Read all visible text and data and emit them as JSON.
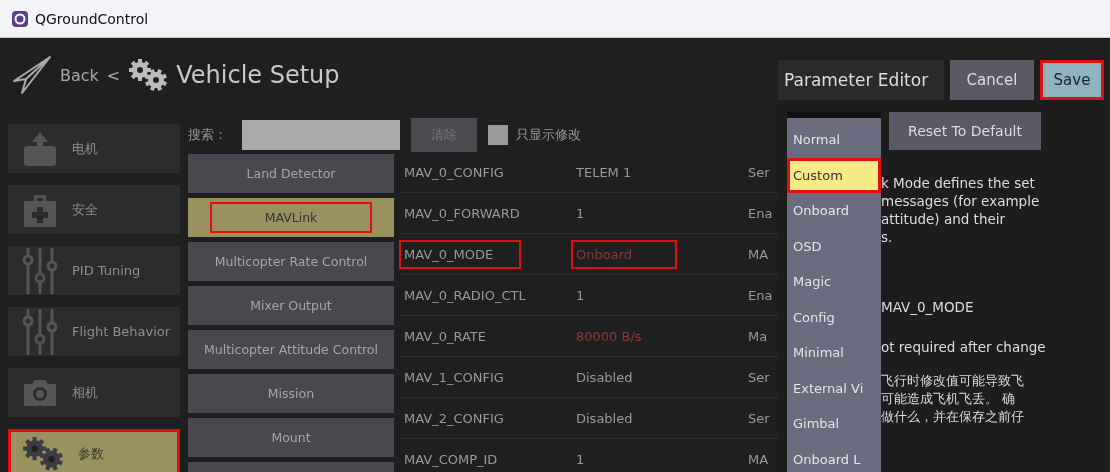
{
  "window": {
    "title": "QGroundControl"
  },
  "header": {
    "back": "Back",
    "separator": "<",
    "title": "Vehicle Setup"
  },
  "sidebar": {
    "items": [
      {
        "label": "电机",
        "kind": "motor",
        "selected": false,
        "highlighted": false
      },
      {
        "label": "安全",
        "kind": "safety",
        "selected": false,
        "highlighted": false
      },
      {
        "label": "PID Tuning",
        "kind": "sliders",
        "selected": false,
        "highlighted": false
      },
      {
        "label": "Flight Behavior",
        "kind": "sliders",
        "selected": false,
        "highlighted": false
      },
      {
        "label": "相机",
        "kind": "camera",
        "selected": false,
        "highlighted": false
      },
      {
        "label": "参数",
        "kind": "gears",
        "selected": true,
        "highlighted": true
      }
    ]
  },
  "search": {
    "label": "搜索：",
    "clear": "清除",
    "modified_only": {
      "label": "只显示修改",
      "checked": false
    }
  },
  "groups": [
    {
      "label": "Land Detector",
      "selected": false,
      "highlighted": false
    },
    {
      "label": "MAVLink",
      "selected": true,
      "highlighted": true
    },
    {
      "label": "Multicopter Rate Control",
      "selected": false,
      "highlighted": false
    },
    {
      "label": "Mixer Output",
      "selected": false,
      "highlighted": false
    },
    {
      "label": "Multicopter Attitude Control",
      "selected": false,
      "highlighted": false
    },
    {
      "label": "Mission",
      "selected": false,
      "highlighted": false
    },
    {
      "label": "Mount",
      "selected": false,
      "highlighted": false
    },
    {
      "selected": false
    }
  ],
  "parameters": [
    {
      "name": "MAV_0_CONFIG",
      "value": "TELEM 1",
      "description": "Ser",
      "modified": false,
      "highlighted": false
    },
    {
      "name": "MAV_0_FORWARD",
      "value": "1",
      "description": "Ena",
      "modified": false,
      "highlighted": false
    },
    {
      "name": "MAV_0_MODE",
      "value": "Onboard",
      "description": "MA",
      "modified": true,
      "highlighted": true
    },
    {
      "name": "MAV_0_RADIO_CTL",
      "value": "1",
      "description": "Ena",
      "modified": false,
      "highlighted": false
    },
    {
      "name": "MAV_0_RATE",
      "value": "80000 B/s",
      "description": "Ma",
      "modified": true,
      "highlighted": false
    },
    {
      "name": "MAV_1_CONFIG",
      "value": "Disabled",
      "description": "Ser",
      "modified": false,
      "highlighted": false
    },
    {
      "name": "MAV_2_CONFIG",
      "value": "Disabled",
      "description": "Ser",
      "modified": false,
      "highlighted": false
    },
    {
      "name": "MAV_COMP_ID",
      "value": "1",
      "description": "MA",
      "modified": false,
      "highlighted": false
    }
  ],
  "dialog": {
    "title": "Parameter Editor",
    "cancel": "Cancel",
    "save": {
      "label": "Save",
      "highlighted": true
    },
    "reset": "Reset To Default",
    "description": [
      "k Mode defines the set",
      "messages (for example",
      "attitude) and their",
      "s."
    ],
    "parameter": "MAV_0_MODE",
    "reboot": "ot required after change",
    "warning": [
      "飞行时修改值可能导致飞",
      "可能造成飞机飞丢。 确",
      "做什么，并在保存之前仔"
    ],
    "options": [
      {
        "label": "Normal",
        "selected": false,
        "highlighted": false
      },
      {
        "label": "Custom",
        "selected": true,
        "highlighted": true
      },
      {
        "label": "Onboard",
        "selected": false,
        "highlighted": false
      },
      {
        "label": "OSD",
        "selected": false,
        "highlighted": false
      },
      {
        "label": "Magic",
        "selected": false,
        "highlighted": false
      },
      {
        "label": "Config",
        "selected": false,
        "highlighted": false
      },
      {
        "label": "Minimal",
        "selected": false,
        "highlighted": false
      },
      {
        "label": "External Vi",
        "selected": false,
        "highlighted": false
      },
      {
        "label": "Gimbal",
        "selected": false,
        "highlighted": false
      },
      {
        "label": "Onboard L",
        "selected": false,
        "highlighted": false
      }
    ]
  }
}
